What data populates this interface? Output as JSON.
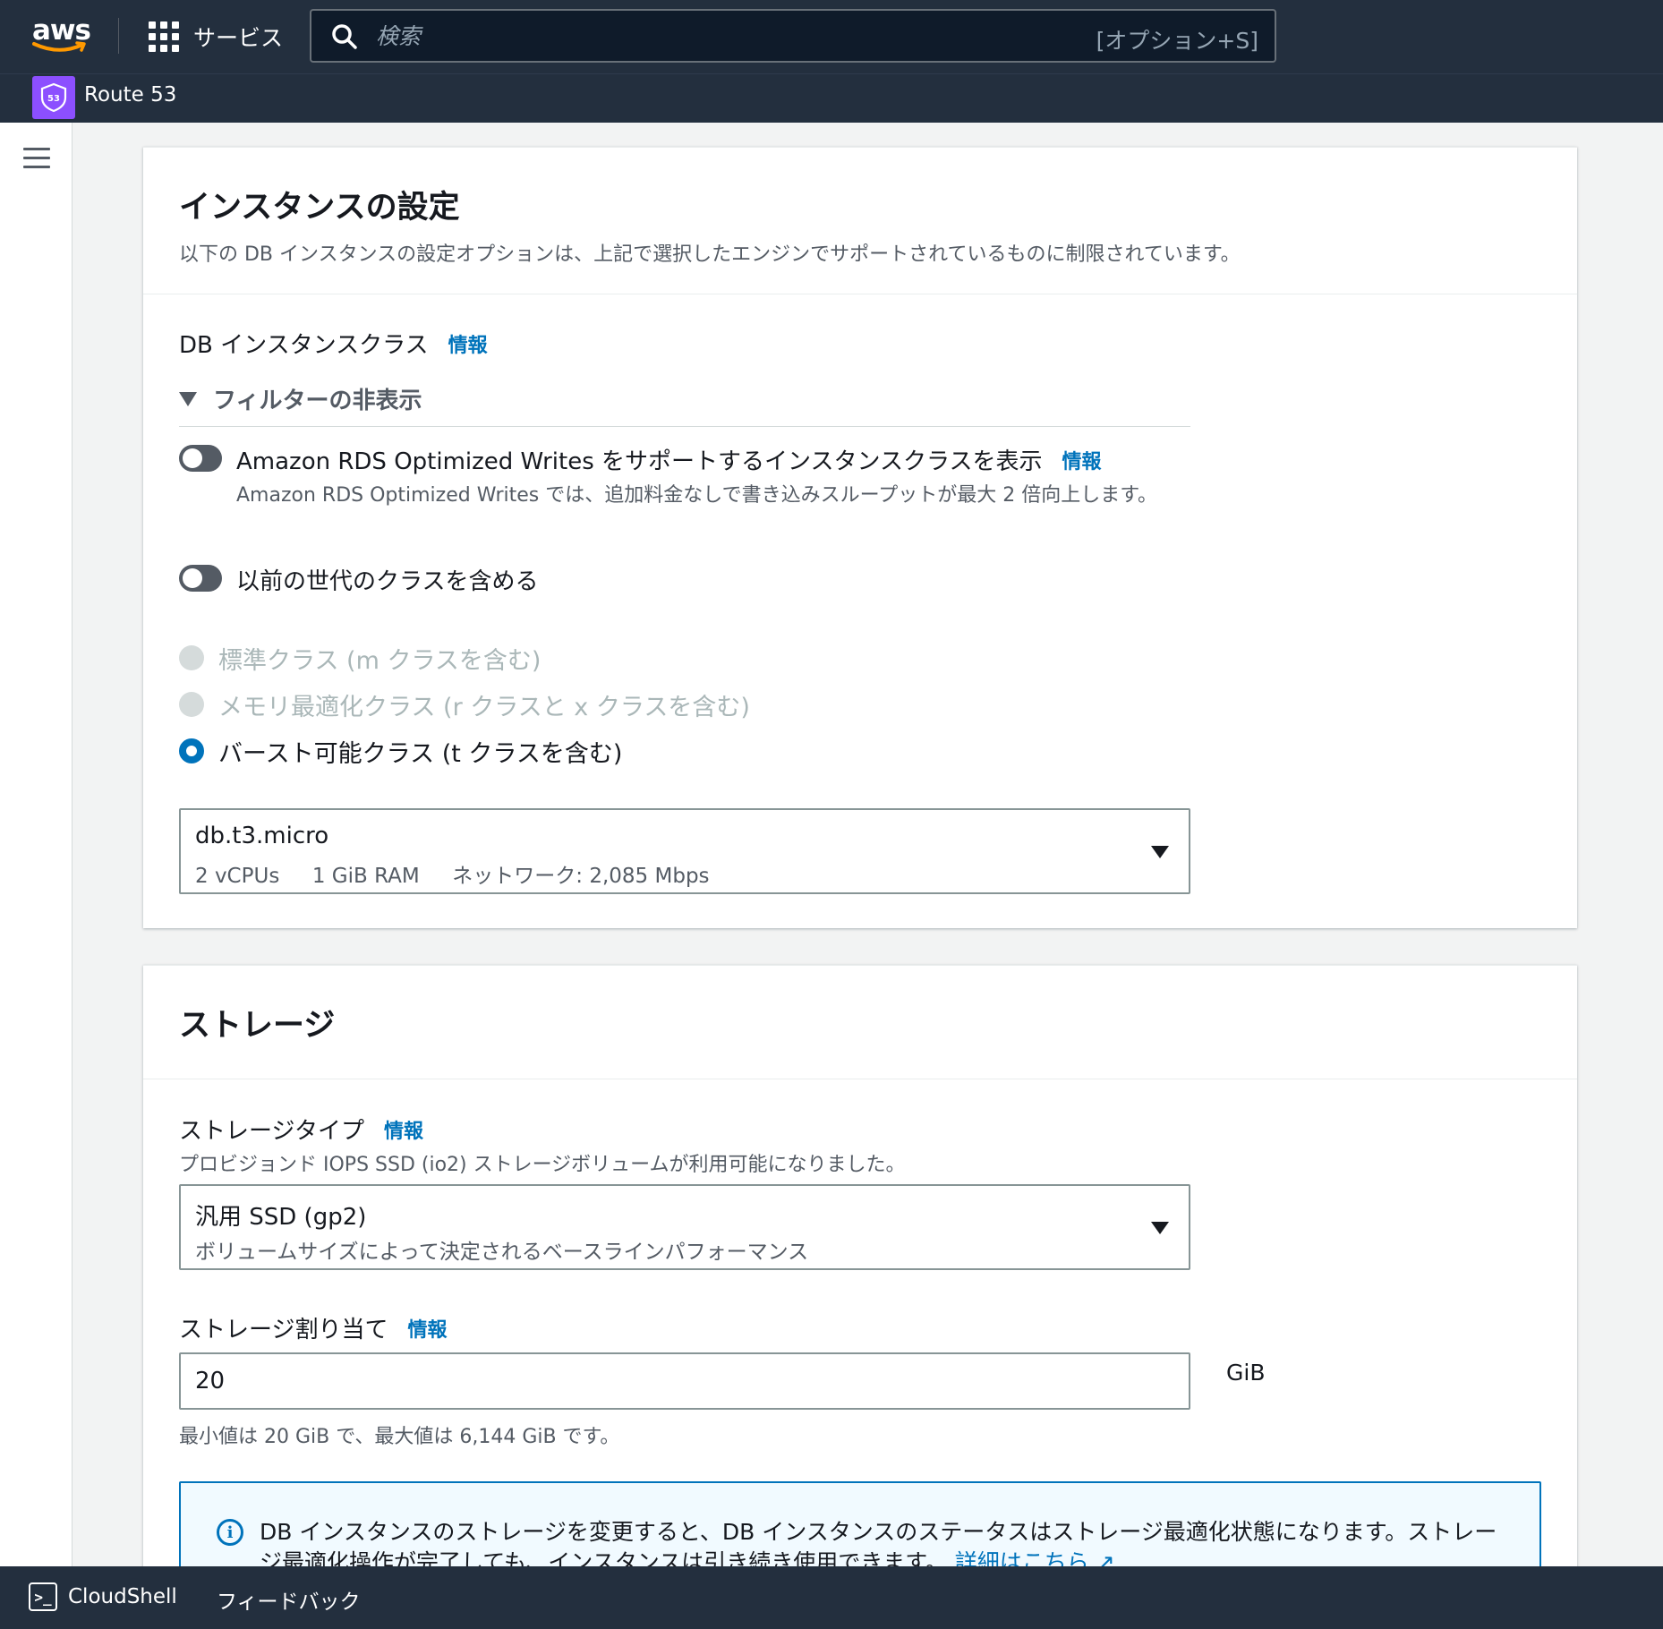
{
  "nav": {
    "aws_logo": "aws",
    "services_label": "サービス",
    "search_placeholder": "検索",
    "search_shortcut": "[オプション+S]",
    "service_badge": "53",
    "service_name": "Route 53"
  },
  "instance_settings": {
    "title": "インスタンスの設定",
    "description": "以下の DB インスタンスの設定オプションは、上記で選択したエンジンでサポートされているものに制限されています。",
    "class_label": "DB インスタンスクラス",
    "info": "情報",
    "filter_toggle_label": "フィルターの非表示",
    "optimized_writes": {
      "label": "Amazon RDS Optimized Writes をサポートするインスタンスクラスを表示",
      "info": "情報",
      "description": "Amazon RDS Optimized Writes では、追加料金なしで書き込みスループットが最大 2 倍向上します。",
      "enabled": false
    },
    "previous_gen": {
      "label": "以前の世代のクラスを含める",
      "enabled": false
    },
    "class_options": [
      {
        "label": "標準クラス (m クラスを含む)",
        "disabled": true,
        "selected": false
      },
      {
        "label": "メモリ最適化クラス (r クラスと x クラスを含む)",
        "disabled": true,
        "selected": false
      },
      {
        "label": "バースト可能クラス (t クラスを含む)",
        "disabled": false,
        "selected": true
      }
    ],
    "selected_class": {
      "name": "db.t3.micro",
      "specs": "2 vCPUs     1 GiB RAM     ネットワーク: 2,085 Mbps"
    }
  },
  "storage": {
    "title": "ストレージ",
    "type_label": "ストレージタイプ",
    "info": "情報",
    "type_hint": "プロビジョンド IOPS SSD (io2) ストレージボリュームが利用可能になりました。",
    "selected_type": {
      "name": "汎用 SSD (gp2)",
      "description": "ボリュームサイズによって決定されるベースラインパフォーマンス"
    },
    "allocation_label": "ストレージ割り当て",
    "allocation_value": "20",
    "allocation_unit": "GiB",
    "allocation_hint": "最小値は 20 GiB で、最大値は 6,144 GiB です。",
    "alert_text": "DB インスタンスのストレージを変更すると、DB インスタンスのステータスはストレージ最適化状態になります。ストレージ最適化操作が完了しても、インスタンスは引き続き使用できます。",
    "alert_link": "詳細はこちら"
  },
  "footer": {
    "cloudshell": "CloudShell",
    "feedback": "フィードバック"
  },
  "colors": {
    "nav_bg": "#232f3e",
    "link": "#0073bb",
    "route53": "#8c4fff",
    "disabled": "#aab7b8"
  }
}
